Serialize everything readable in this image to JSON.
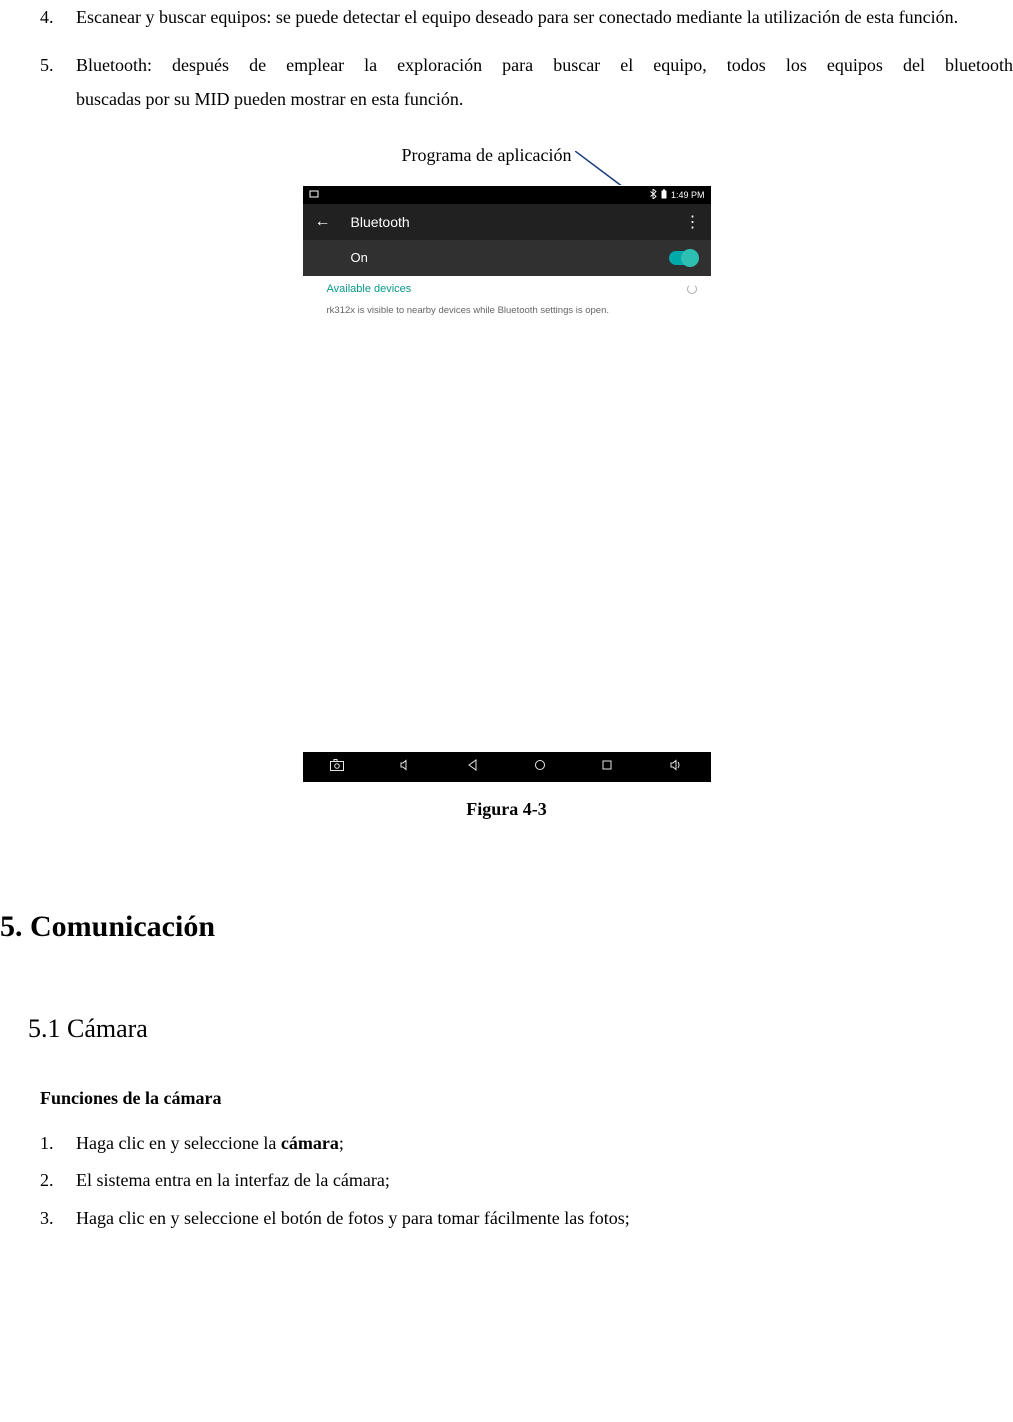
{
  "doc": {
    "items": [
      {
        "num": "4.",
        "text": "Escanear y buscar equipos: se puede detectar el equipo deseado para ser conectado mediante la utilización de esta función."
      },
      {
        "num": "5.",
        "line1": "Bluetooth: después de emplear la exploración para buscar el equipo, todos los equipos del bluetooth",
        "line2": "buscadas por su MID pueden mostrar en esta función."
      }
    ],
    "annotation": "Programa de aplicación",
    "figure_caption": "Figura 4-3",
    "h1": "5. Comunicación",
    "h2": "5.1 Cámara",
    "h3": "Funciones de la cámara",
    "sublist": [
      {
        "num": "1.",
        "pre": "Haga clic en y seleccione la ",
        "bold": "cámara",
        "post": ";"
      },
      {
        "num": "2.",
        "pre": "El sistema entra en la interfaz de la cámara;",
        "bold": "",
        "post": ""
      },
      {
        "num": "3.",
        "pre": "Haga clic en y seleccione el botón de fotos y para tomar fácilmente las fotos;",
        "bold": "",
        "post": ""
      }
    ]
  },
  "shot": {
    "statusbar": {
      "time": "1:49 PM"
    },
    "titlebar": {
      "title": "Bluetooth"
    },
    "onrow": {
      "label": "On"
    },
    "avail": {
      "label": "Available devices"
    },
    "visible": {
      "text": "rk312x is visible to nearby devices while Bluetooth settings is open."
    }
  }
}
